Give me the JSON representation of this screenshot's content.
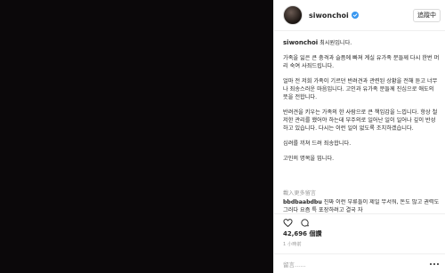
{
  "header": {
    "username": "siwonchoi",
    "follow_label": "追蹤中"
  },
  "caption": {
    "username": "siwonchoi",
    "intro": "최시원입니다.",
    "paragraphs": [
      "가족을 잃은 큰 충격과 슬픔에 빠져 계실 유가족 분들께 다시 한번 머리 숙여 사죄드립니다.",
      "얼마 전 저희 가족이 기르던 반려견과 관련된 상황을 전해 듣고 너무나 죄송스러운 마음입니다. 고인과 유가족 분들께 진심으로 애도의 뜻을 전합니다.",
      "반려견을 키우는 가족의 한 사람으로 큰 책임감을 느낍니다. 항상 철저한 관리를 했어야 하는데 부주의로 일어난 일이 일어나 깊이 반성하고 있습니다. 다시는 이런 일이 없도록 조치하겠습니다.",
      "심려를 끼쳐 드려 죄송합니다.",
      "고인의 명복을 빕니다."
    ]
  },
  "more_comments_label": "載入更多留言",
  "comment": {
    "username": "bbdbaabdbu",
    "text": "진짜 이런 부류들이 제일 무서워, 돈도 많고 권력도 그러다 요즘 특 포장하려고 결국 자"
  },
  "stats": {
    "likes": "42,696",
    "likes_unit": "個讚",
    "time": "1 小時前"
  },
  "add_comment_placeholder": "留言......",
  "icons": {
    "like": "heart-icon",
    "comment": "comment-icon",
    "verified": "verified-badge-icon",
    "more": "more-options-icon"
  },
  "colors": {
    "verified": "#3897f0",
    "media_background": "#0b080a",
    "muted_text": "#999999"
  }
}
